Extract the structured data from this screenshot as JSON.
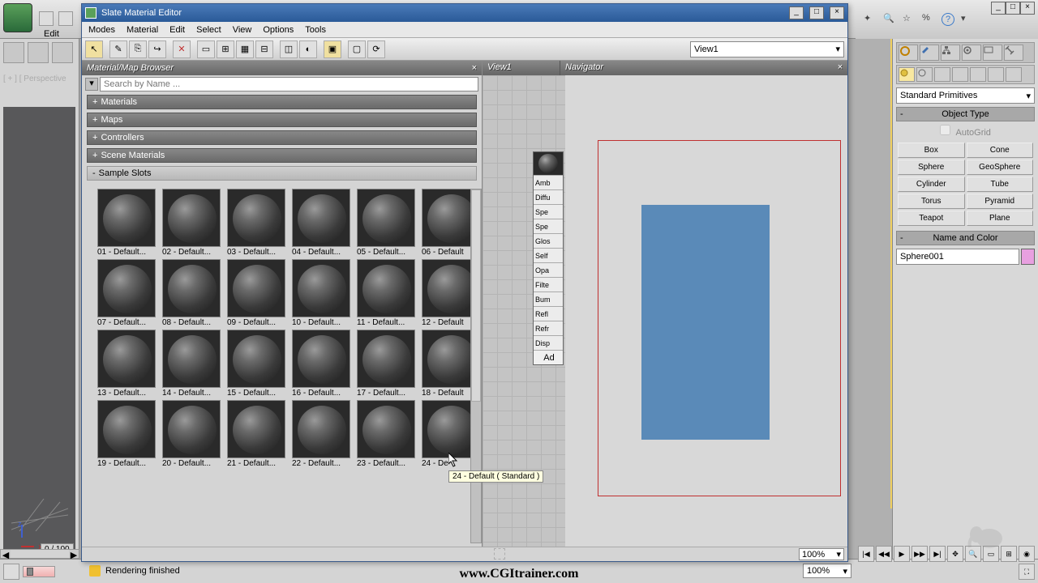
{
  "app": {
    "edit_menu": "Edit",
    "help_icon": "?"
  },
  "slate": {
    "title": "Slate Material Editor",
    "menu": [
      "Modes",
      "Material",
      "Edit",
      "Select",
      "View",
      "Options",
      "Tools"
    ],
    "view_dropdown": "View1",
    "browser_title": "Material/Map Browser",
    "search_placeholder": "Search by Name ...",
    "categories": [
      {
        "label": "Materials",
        "expand": "+"
      },
      {
        "label": "Maps",
        "expand": "+"
      },
      {
        "label": "Controllers",
        "expand": "+"
      },
      {
        "label": "Scene Materials",
        "expand": "+"
      }
    ],
    "sample_slots_label": "Sample Slots",
    "sample_slots_expand": "-",
    "slots": [
      "01 - Default...",
      "02 - Default...",
      "03 - Default...",
      "04 - Default...",
      "05 - Default...",
      "06 - Default",
      "07 - Default...",
      "08 - Default...",
      "09 - Default...",
      "10 - Default...",
      "11 - Default...",
      "12 - Default",
      "13 - Default...",
      "14 - Default...",
      "15 - Default...",
      "16 - Default...",
      "17 - Default...",
      "18 - Default",
      "19 - Default...",
      "20 - Default...",
      "21 - Default...",
      "22 - Default...",
      "23 - Default...",
      "24 - De"
    ],
    "view_tab": "View1",
    "navigator_tab": "Navigator",
    "node_rows": [
      "Amb",
      "Diffu",
      "Spe",
      "Spe",
      "Glos",
      "Self",
      "Opa",
      "Filte",
      "Bum",
      "Refl",
      "Refr",
      "Disp"
    ],
    "node_add": "Ad",
    "tooltip": "24 - Default  ( Standard )",
    "zoom": "100%"
  },
  "cmd": {
    "dropdown": "Standard Primitives",
    "object_type": "Object Type",
    "autogrid": "AutoGrid",
    "primitives": [
      "Box",
      "Cone",
      "Sphere",
      "GeoSphere",
      "Cylinder",
      "Tube",
      "Torus",
      "Pyramid",
      "Teapot",
      "Plane"
    ],
    "name_color": "Name and Color",
    "object_name": "Sphere001"
  },
  "viewport": {
    "label": "[ + ] [ Perspective"
  },
  "timeline": {
    "frame": "0 / 100"
  },
  "status": {
    "text": "Rendering finished"
  },
  "watermark": "www.CGItrainer.com",
  "bottom_zoom": "100%"
}
